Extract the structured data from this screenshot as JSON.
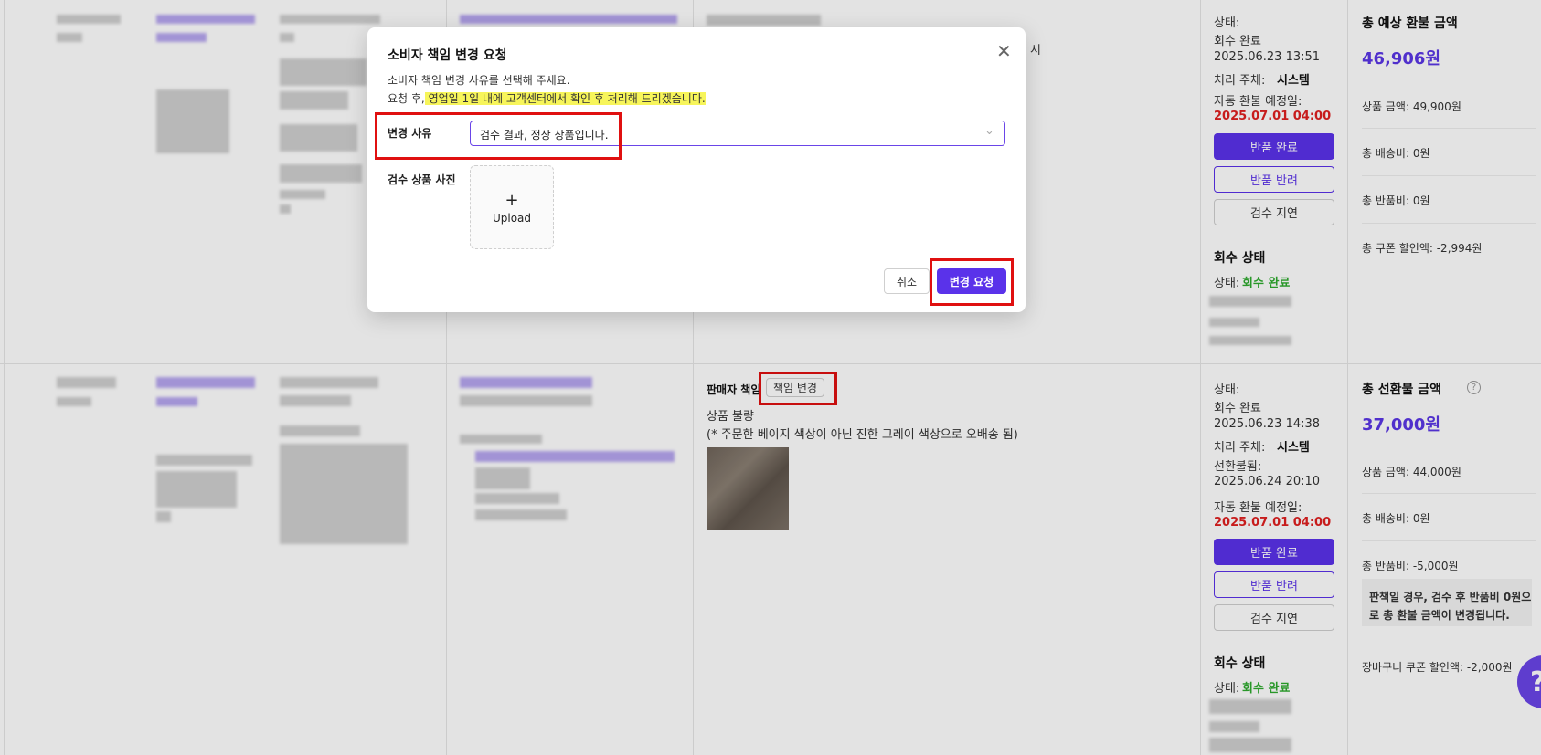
{
  "top": {
    "status_label": "상태:",
    "status_value": "회수 완료",
    "datetime": "2025.06.23 13:51",
    "handler_label": "처리 주체:",
    "handler_value": "시스템",
    "auto_refund_label": "자동 환불 예정일:",
    "auto_refund_date": "2025.07.01 04:00",
    "buttons": {
      "complete": "반품 완료",
      "reject": "반품 반려",
      "delay": "검수 지연"
    },
    "recovery_title": "회수 상태",
    "recovery_status_label": "상태:",
    "recovery_status_value": "회수 완료",
    "summary": {
      "title": "총 예상 환불 금액",
      "amount": "46,906원",
      "lines": [
        "상품 금액: 49,900원",
        "총 배송비: 0원",
        "총 반품비: 0원",
        "총 쿠폰 할인액: -2,994원"
      ]
    },
    "partial_text": "시"
  },
  "bottom": {
    "responsibility_label": "판매자 책임",
    "change_button": "책임 변경",
    "reason_title": "상품 불량",
    "reason_detail": "(* 주문한 베이지 색상이 아닌 진한 그레이 색상으로 오배송 됨)",
    "status_label": "상태:",
    "status_value": "회수 완료",
    "datetime": "2025.06.23 14:38",
    "handler_label": "처리 주체:",
    "handler_value": "시스템",
    "prepaid_label": "선환불됨:",
    "prepaid_date": "2025.06.24 20:10",
    "auto_refund_label": "자동 환불 예정일:",
    "auto_refund_date": "2025.07.01 04:00",
    "buttons": {
      "complete": "반품 완료",
      "reject": "반품 반려",
      "delay": "검수 지연"
    },
    "recovery_title": "회수 상태",
    "recovery_status_label": "상태:",
    "recovery_status_value": "회수 완료",
    "summary": {
      "title": "총 선환불 금액",
      "amount": "37,000원",
      "lines": [
        "상품 금액: 44,000원",
        "총 배송비: 0원",
        "총 반품비: -5,000원"
      ],
      "notice_1": "판책일 경우, 검수 후 반품비 0원으",
      "notice_2": "로 총 환불 금액이 변경됩니다.",
      "cart_coupon": "장바구니 쿠폰 할인액: -2,000원"
    }
  },
  "modal": {
    "title": "소비자 책임 변경 요청",
    "desc_1": "소비자 책임 변경 사유를 선택해 주세요.",
    "desc_2_prefix": "요청 후,",
    "desc_2_highlight": " 영업일 1일 내에 고객센터에서 확인 후 처리해 드리겠습니다.",
    "reason_label": "변경 사유",
    "reason_value": "검수 결과, 정상 상품입니다.",
    "photo_label": "검수 상품 사진",
    "upload_label": "Upload",
    "cancel": "취소",
    "submit": "변경 요청"
  },
  "colors": {
    "primary": "#5a32ea",
    "danger": "#e02020",
    "success": "#2eaa2e",
    "highlight": "#f7f55a"
  }
}
